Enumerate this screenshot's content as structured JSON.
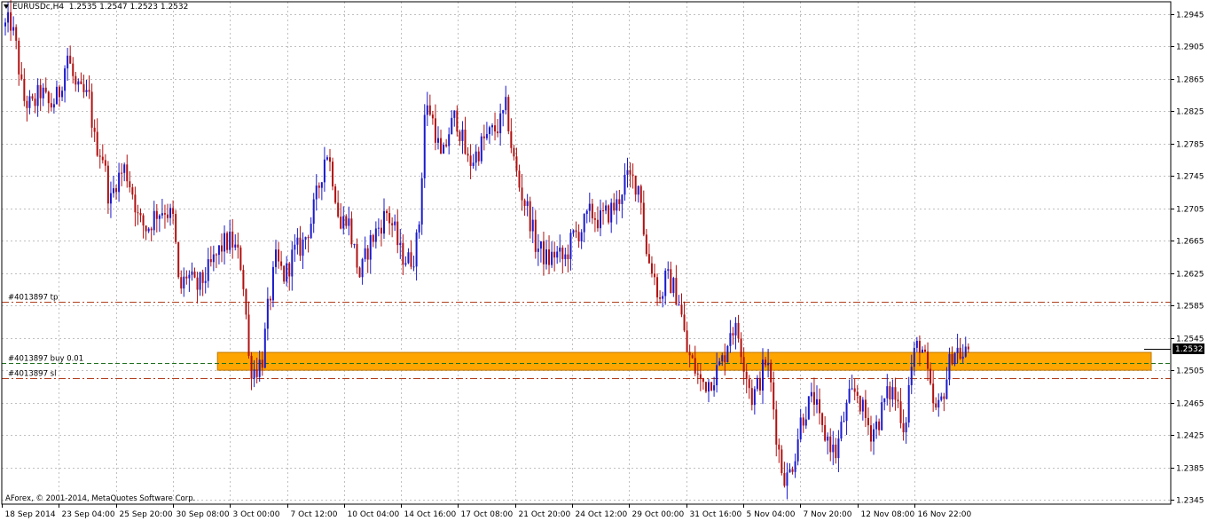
{
  "header": {
    "symbol_timeframe": "EURUSDc,H4",
    "ohlc": "1.2535 1.2547 1.2523 1.2532"
  },
  "copyright": "AForex, © 2001-2014, MetaQuotes Software Corp.",
  "current_price_label": "1.2532",
  "colors": {
    "background": "#ffffff",
    "grid": "#c0c0c0",
    "bull_candle": "#1a1acc",
    "bear_candle": "#b01010",
    "zone_fill": "#ffa500",
    "tp_line": "#b04020",
    "sl_line": "#b04020",
    "entry_line": "#207020",
    "price_tag_bg": "#000000"
  },
  "chart_data": {
    "type": "candlestick",
    "title": "EURUSDc,H4",
    "ylim": [
      1.2345,
      1.296
    ],
    "price_ticks": [
      "1.2945",
      "1.2905",
      "1.2865",
      "1.2825",
      "1.2785",
      "1.2745",
      "1.2705",
      "1.2665",
      "1.2625",
      "1.2585",
      "1.2545",
      "1.2505",
      "1.2465",
      "1.2425",
      "1.2385",
      "1.2345"
    ],
    "time_ticks": [
      "18 Sep 2014",
      "23 Sep 04:00",
      "25 Sep 20:00",
      "30 Sep 08:00",
      "3 Oct 00:00",
      "7 Oct 12:00",
      "10 Oct 04:00",
      "14 Oct 16:00",
      "17 Oct 08:00",
      "21 Oct 20:00",
      "24 Oct 12:00",
      "29 Oct 00:00",
      "31 Oct 16:00",
      "5 Nov 04:00",
      "7 Nov 20:00",
      "12 Nov 08:00",
      "16 Nov 22:00"
    ],
    "trade_lines": [
      {
        "label": "#4013897 tp",
        "price": 1.259,
        "style": "dash-dot"
      },
      {
        "label": "#4013897 buy 0.01",
        "price": 1.2514,
        "style": "dashed"
      },
      {
        "label": "#4013897 sl",
        "price": 1.2495,
        "style": "dash-dot"
      }
    ],
    "zone": {
      "from_price": 1.2505,
      "to_price": 1.2527,
      "from_label": "3 Oct 00:00"
    },
    "close_path": [
      [
        0,
        1.293
      ],
      [
        6,
        1.2935
      ],
      [
        12,
        1.2905
      ],
      [
        20,
        1.284
      ],
      [
        30,
        1.283
      ],
      [
        40,
        1.285
      ],
      [
        50,
        1.283
      ],
      [
        60,
        1.2845
      ],
      [
        70,
        1.2895
      ],
      [
        80,
        1.285
      ],
      [
        95,
        1.284
      ],
      [
        100,
        1.279
      ],
      [
        110,
        1.277
      ],
      [
        118,
        1.271
      ],
      [
        125,
        1.274
      ],
      [
        135,
        1.2755
      ],
      [
        145,
        1.272
      ],
      [
        150,
        1.269
      ],
      [
        160,
        1.268
      ],
      [
        170,
        1.27
      ],
      [
        180,
        1.2705
      ],
      [
        190,
        1.269
      ],
      [
        196,
        1.26
      ],
      [
        205,
        1.2625
      ],
      [
        215,
        1.2605
      ],
      [
        225,
        1.262
      ],
      [
        235,
        1.264
      ],
      [
        245,
        1.266
      ],
      [
        255,
        1.2665
      ],
      [
        265,
        1.264
      ],
      [
        270,
        1.26
      ],
      [
        275,
        1.251
      ],
      [
        282,
        1.2505
      ],
      [
        290,
        1.252
      ],
      [
        296,
        1.258
      ],
      [
        305,
        1.264
      ],
      [
        315,
        1.262
      ],
      [
        325,
        1.265
      ],
      [
        335,
        1.266
      ],
      [
        345,
        1.269
      ],
      [
        355,
        1.274
      ],
      [
        362,
        1.278
      ],
      [
        370,
        1.274
      ],
      [
        378,
        1.268
      ],
      [
        385,
        1.27
      ],
      [
        392,
        1.266
      ],
      [
        400,
        1.262
      ],
      [
        410,
        1.266
      ],
      [
        420,
        1.268
      ],
      [
        430,
        1.27
      ],
      [
        438,
        1.268
      ],
      [
        445,
        1.265
      ],
      [
        455,
        1.264
      ],
      [
        462,
        1.265
      ],
      [
        468,
        1.27
      ],
      [
        472,
        1.282
      ],
      [
        478,
        1.283
      ],
      [
        485,
        1.28
      ],
      [
        492,
        1.276
      ],
      [
        500,
        1.28
      ],
      [
        508,
        1.282
      ],
      [
        515,
        1.279
      ],
      [
        522,
        1.276
      ],
      [
        530,
        1.277
      ],
      [
        540,
        1.279
      ],
      [
        550,
        1.28
      ],
      [
        558,
        1.281
      ],
      [
        565,
        1.283
      ],
      [
        572,
        1.277
      ],
      [
        580,
        1.273
      ],
      [
        590,
        1.27
      ],
      [
        598,
        1.266
      ],
      [
        605,
        1.265
      ],
      [
        612,
        1.264
      ],
      [
        620,
        1.265
      ],
      [
        630,
        1.264
      ],
      [
        640,
        1.267
      ],
      [
        650,
        1.268
      ],
      [
        660,
        1.27
      ],
      [
        670,
        1.269
      ],
      [
        680,
        1.27
      ],
      [
        690,
        1.271
      ],
      [
        698,
        1.274
      ],
      [
        708,
        1.274
      ],
      [
        716,
        1.273
      ],
      [
        722,
        1.265
      ],
      [
        730,
        1.263
      ],
      [
        738,
        1.259
      ],
      [
        745,
        1.262
      ],
      [
        752,
        1.261
      ],
      [
        760,
        1.259
      ],
      [
        768,
        1.253
      ],
      [
        776,
        1.251
      ],
      [
        784,
        1.249
      ],
      [
        792,
        1.249
      ],
      [
        800,
        1.25
      ],
      [
        810,
        1.252
      ],
      [
        818,
        1.256
      ],
      [
        826,
        1.255
      ],
      [
        834,
        1.251
      ],
      [
        842,
        1.247
      ],
      [
        850,
        1.249
      ],
      [
        858,
        1.252
      ],
      [
        864,
        1.248
      ],
      [
        870,
        1.242
      ],
      [
        876,
        1.238
      ],
      [
        882,
        1.237
      ],
      [
        890,
        1.24
      ],
      [
        896,
        1.244
      ],
      [
        904,
        1.246
      ],
      [
        912,
        1.247
      ],
      [
        920,
        1.243
      ],
      [
        928,
        1.242
      ],
      [
        936,
        1.24
      ],
      [
        944,
        1.244
      ],
      [
        952,
        1.247
      ],
      [
        960,
        1.248
      ],
      [
        968,
        1.245
      ],
      [
        976,
        1.243
      ],
      [
        984,
        1.244
      ],
      [
        992,
        1.247
      ],
      [
        1000,
        1.248
      ],
      [
        1008,
        1.246
      ],
      [
        1014,
        1.243
      ],
      [
        1020,
        1.25
      ],
      [
        1026,
        1.253
      ],
      [
        1032,
        1.254
      ],
      [
        1038,
        1.251
      ],
      [
        1044,
        1.247
      ],
      [
        1050,
        1.245
      ],
      [
        1056,
        1.247
      ],
      [
        1062,
        1.25
      ],
      [
        1068,
        1.253
      ],
      [
        1074,
        1.253
      ],
      [
        1080,
        1.252
      ],
      [
        1086,
        1.2532
      ]
    ]
  }
}
